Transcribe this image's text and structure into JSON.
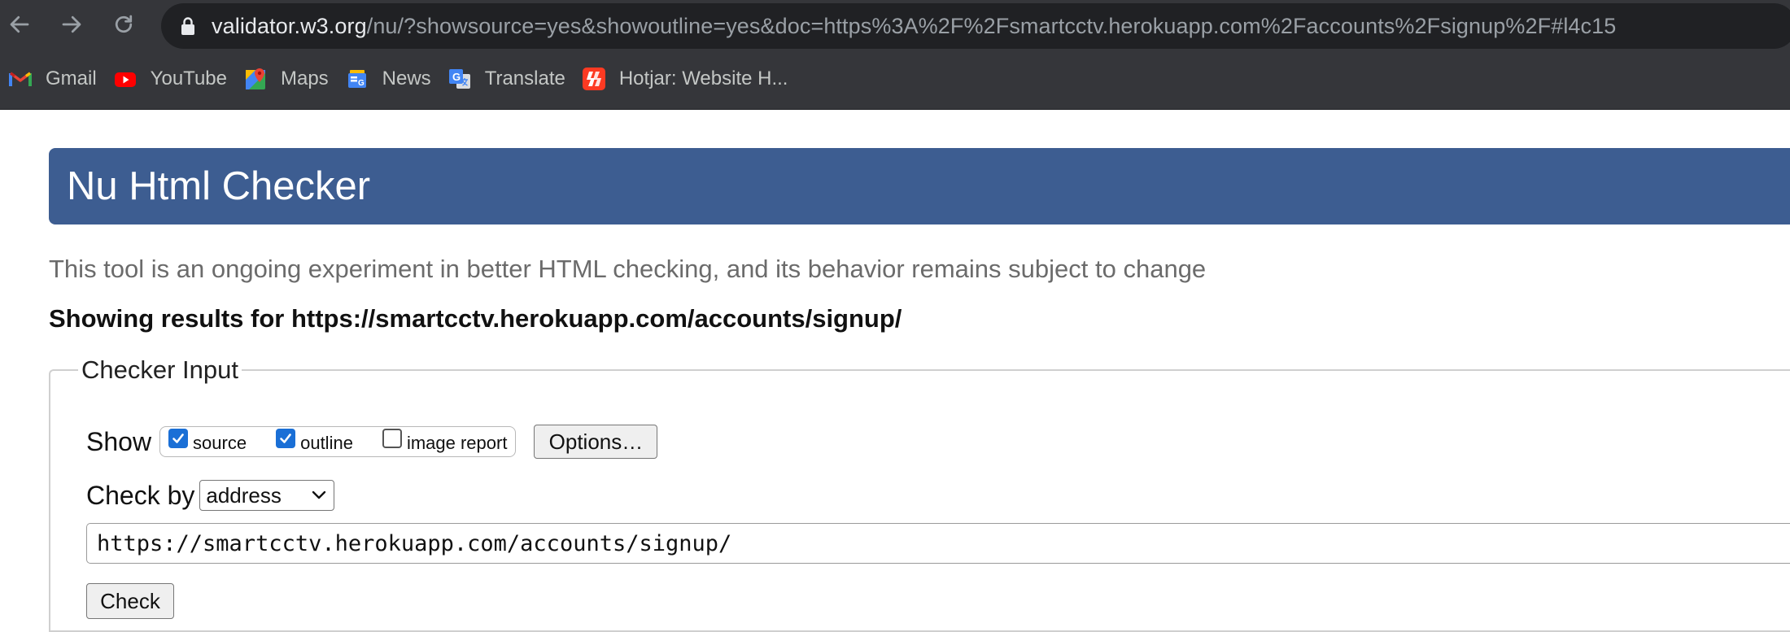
{
  "browser": {
    "url_domain": "validator.w3.org",
    "url_rest": "/nu/?showsource=yes&showoutline=yes&doc=https%3A%2F%2Fsmartcctv.herokuapp.com%2Faccounts%2Fsignup%2F#l4c15",
    "bookmarks": [
      {
        "label": "Gmail",
        "icon": "gmail-icon"
      },
      {
        "label": "YouTube",
        "icon": "youtube-icon"
      },
      {
        "label": "Maps",
        "icon": "maps-icon"
      },
      {
        "label": "News",
        "icon": "news-icon"
      },
      {
        "label": "Translate",
        "icon": "translate-icon"
      },
      {
        "label": "Hotjar: Website H...",
        "icon": "hotjar-icon"
      }
    ]
  },
  "page": {
    "title": "Nu Html Checker",
    "tagline": "This tool is an ongoing experiment in better HTML checking, and its behavior remains subject to change",
    "results_heading": "Showing results for https://smartcctv.herokuapp.com/accounts/signup/",
    "checker_input": {
      "legend": "Checker Input",
      "show_label": "Show",
      "options": [
        {
          "label": "source",
          "checked": true
        },
        {
          "label": "outline",
          "checked": true
        },
        {
          "label": "image report",
          "checked": false
        }
      ],
      "options_button": "Options…",
      "check_by_label": "Check by",
      "check_by_value": "address",
      "url_value": "https://smartcctv.herokuapp.com/accounts/signup/",
      "check_button": "Check"
    }
  },
  "colors": {
    "banner": "#3d5d91",
    "chrome_bg": "#35363a",
    "omnibox_bg": "#202124",
    "checkbox_accent": "#1a6fd6"
  }
}
